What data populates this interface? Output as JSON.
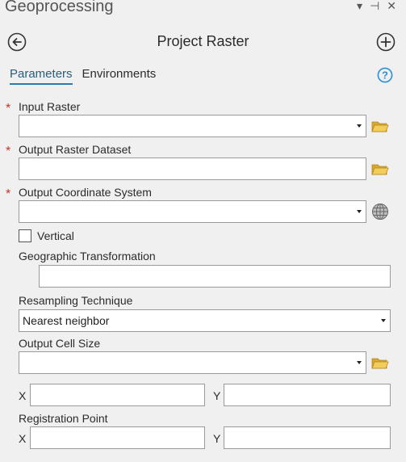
{
  "pane": {
    "title": "Geoprocessing",
    "controls": {
      "dropdown": "▾",
      "pin": "⊣",
      "close": "✕"
    }
  },
  "tool": {
    "title": "Project Raster"
  },
  "tabs": [
    {
      "label": "Parameters",
      "active": true
    },
    {
      "label": "Environments",
      "active": false
    }
  ],
  "params": {
    "input_raster": {
      "label": "Input Raster",
      "required": true,
      "value": ""
    },
    "output_raster": {
      "label": "Output Raster Dataset",
      "required": true,
      "value": ""
    },
    "output_cs": {
      "label": "Output Coordinate System",
      "required": true,
      "value": ""
    },
    "vertical": {
      "label": "Vertical",
      "checked": false
    },
    "geo_transform": {
      "label": "Geographic Transformation",
      "value": ""
    },
    "resampling": {
      "label": "Resampling Technique",
      "value": "Nearest neighbor"
    },
    "cell_size": {
      "label": "Output Cell Size",
      "value": ""
    },
    "cell_xy": {
      "x_label": "X",
      "y_label": "Y",
      "x_value": "",
      "y_value": ""
    },
    "registration": {
      "label": "Registration Point",
      "x_label": "X",
      "y_label": "Y",
      "x_value": "",
      "y_value": ""
    }
  },
  "required_marker": "*",
  "icons": {
    "back": "back-arrow-icon",
    "add": "add-plus-icon",
    "help": "help-question-icon",
    "folder": "folder-icon",
    "globe": "globe-icon"
  },
  "colors": {
    "accent": "#2a7ab0",
    "required": "#c0392b",
    "folder": "#e8c04a",
    "background": "#f0f0f0"
  }
}
